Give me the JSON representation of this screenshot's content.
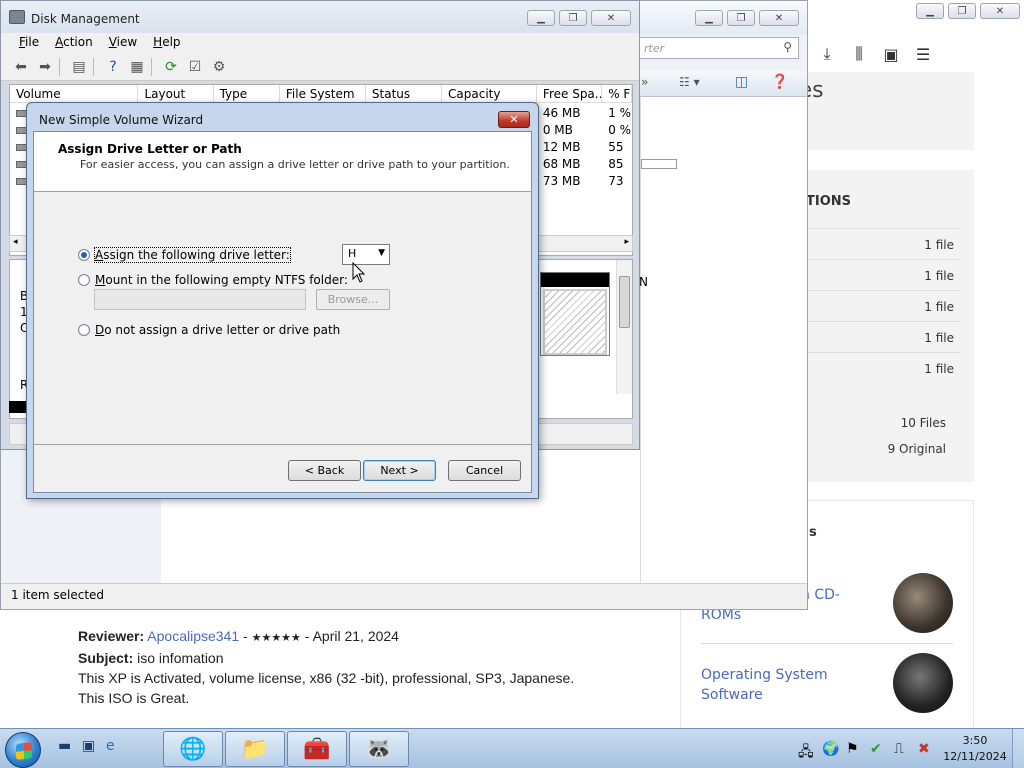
{
  "background_page": {
    "toolbar_icons": [
      "download-icon",
      "library-icon",
      "sidebar-icon",
      "menu-icon"
    ],
    "top_card": {
      "title_fragment": "tes",
      "link_fragment": "s"
    },
    "files_card": {
      "title": "TIONS",
      "rows": [
        "1 file",
        "1 file",
        "1 file",
        "1 file",
        "1 file"
      ],
      "total_files": "10 Files",
      "original": "9 Original"
    },
    "related_card": {
      "title": "s",
      "items": [
        {
          "line1": "n CD-",
          "line2": "ROMs"
        },
        {
          "line1": "Operating System",
          "line2": "Software"
        }
      ]
    },
    "review": {
      "reviewer_label": "Reviewer:",
      "reviewer_name": "Apocalipse341",
      "separator": " - ",
      "stars": "★★★★★",
      "date": " - April 21, 2024",
      "subject_label": "Subject:",
      "subject": " iso infomation",
      "body_line1": "This XP is Activated, volume license, x86 (32 -bit), professional, SP3, Japanese.",
      "body_line2": "This ISO is Great."
    }
  },
  "explorer": {
    "search_placeholder": "rter",
    "partial_label": "N",
    "status": "1 item selected"
  },
  "disk_management": {
    "title": "Disk Management",
    "menus": [
      {
        "key": "F",
        "rest": "ile"
      },
      {
        "key": "A",
        "rest": "ction"
      },
      {
        "key": "V",
        "rest": "iew"
      },
      {
        "key": "H",
        "rest": "elp"
      }
    ],
    "columns": [
      "Volume",
      "Layout",
      "Type",
      "File System",
      "Status",
      "Capacity",
      "Free Spa...",
      "% F"
    ],
    "free_space_rows": [
      {
        "free": "46 MB",
        "pct": "1 %"
      },
      {
        "free": "0 MB",
        "pct": "0 %"
      },
      {
        "free": "12 MB",
        "pct": "55"
      },
      {
        "free": "68 MB",
        "pct": "85"
      },
      {
        "free": "73 MB",
        "pct": "73"
      }
    ],
    "graph_labels": [
      "B",
      "1(",
      "O"
    ],
    "legend_label": "R"
  },
  "wizard": {
    "title": "New Simple Volume Wizard",
    "heading": "Assign Drive Letter or Path",
    "subheading": "For easier access, you can assign a drive letter or drive path to your partition.",
    "options": {
      "assign_letter": {
        "key": "A",
        "rest": "ssign the following drive letter:"
      },
      "mount_folder": {
        "key": "M",
        "rest": "ount in the following empty NTFS folder:"
      },
      "no_assign": {
        "key": "D",
        "rest": "o not assign a drive letter or drive path"
      }
    },
    "selected_option": "assign_letter",
    "drive_letter": "H",
    "browse_label": "Browse...",
    "back_label": "< Back",
    "next_label": "Next >",
    "cancel_label": "Cancel"
  },
  "taskbar": {
    "time": "3:50",
    "date": "12/11/2024",
    "quick_launch": [
      "show-desktop-icon",
      "switch-windows-icon",
      "internet-explorer-icon"
    ],
    "pinned": [
      "internet-download-manager-icon",
      "file-explorer-icon",
      "toolbox-icon",
      "raccoon-app-icon"
    ],
    "tray": [
      "network-icon",
      "globe-icon",
      "action-center-flag-icon",
      "security-icon",
      "network-status-icon",
      "volume-muted-icon"
    ]
  }
}
